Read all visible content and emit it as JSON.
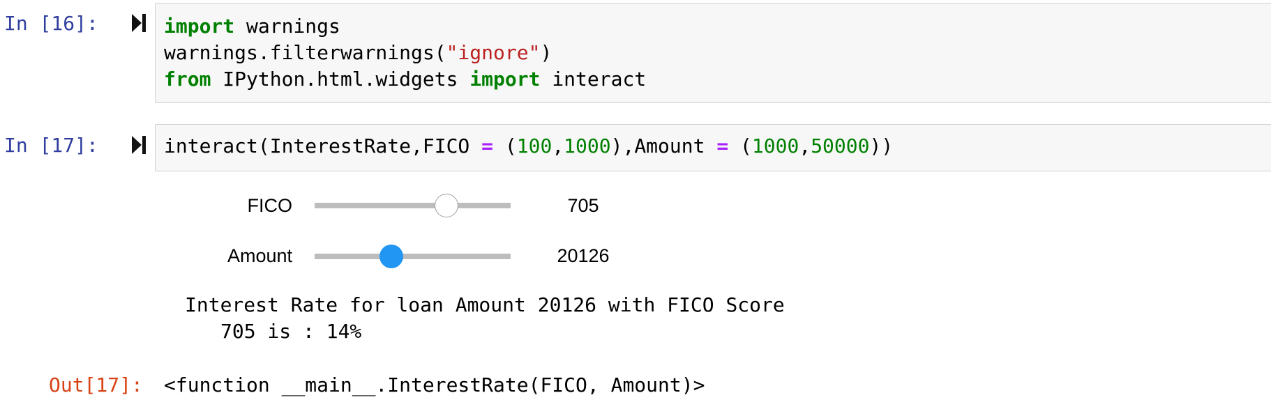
{
  "cells": [
    {
      "prompt": "In [16]:",
      "lines": [
        [
          {
            "t": "import",
            "c": "kw"
          },
          {
            "t": " warnings",
            "c": ""
          }
        ],
        [
          {
            "t": "warnings.filterwarnings(",
            "c": ""
          },
          {
            "t": "\"ignore\"",
            "c": "str"
          },
          {
            "t": ")",
            "c": ""
          }
        ],
        [
          {
            "t": "from",
            "c": "kw"
          },
          {
            "t": " IPython.html.widgets ",
            "c": ""
          },
          {
            "t": "import",
            "c": "kw"
          },
          {
            "t": " interact",
            "c": ""
          }
        ]
      ]
    },
    {
      "prompt": "In [17]:",
      "lines": [
        [
          {
            "t": "interact(InterestRate,FICO ",
            "c": ""
          },
          {
            "t": "=",
            "c": "op"
          },
          {
            "t": " (",
            "c": ""
          },
          {
            "t": "100",
            "c": "num"
          },
          {
            "t": ",",
            "c": ""
          },
          {
            "t": "1000",
            "c": "num"
          },
          {
            "t": "),Amount ",
            "c": ""
          },
          {
            "t": "=",
            "c": "op"
          },
          {
            "t": " (",
            "c": ""
          },
          {
            "t": "1000",
            "c": "num"
          },
          {
            "t": ",",
            "c": ""
          },
          {
            "t": "50000",
            "c": "num"
          },
          {
            "t": "))",
            "c": ""
          }
        ]
      ]
    }
  ],
  "widgets": {
    "fico": {
      "label": "FICO",
      "value": "705",
      "min": 100,
      "max": 1000,
      "fill_fraction": 0.672,
      "handle_style": "white"
    },
    "amount": {
      "label": "Amount",
      "value": "20126",
      "min": 1000,
      "max": 50000,
      "fill_fraction": 0.39,
      "handle_style": "blue"
    }
  },
  "stdout": {
    "line1": "Interest Rate for loan Amount 20126 with FICO Score",
    "line2": "705 is : 14%"
  },
  "output": {
    "prompt": "Out[17]:",
    "text": "<function __main__.InterestRate(FICO, Amount)>"
  },
  "colors": {
    "in_prompt": "#303f9f",
    "out_prompt": "#d84315",
    "keyword": "#008000",
    "string": "#ba2121",
    "number": "#008000",
    "operator": "#aa22ff",
    "slider_active": "#2196f3"
  },
  "icons": {
    "run": "step-forward-icon"
  }
}
